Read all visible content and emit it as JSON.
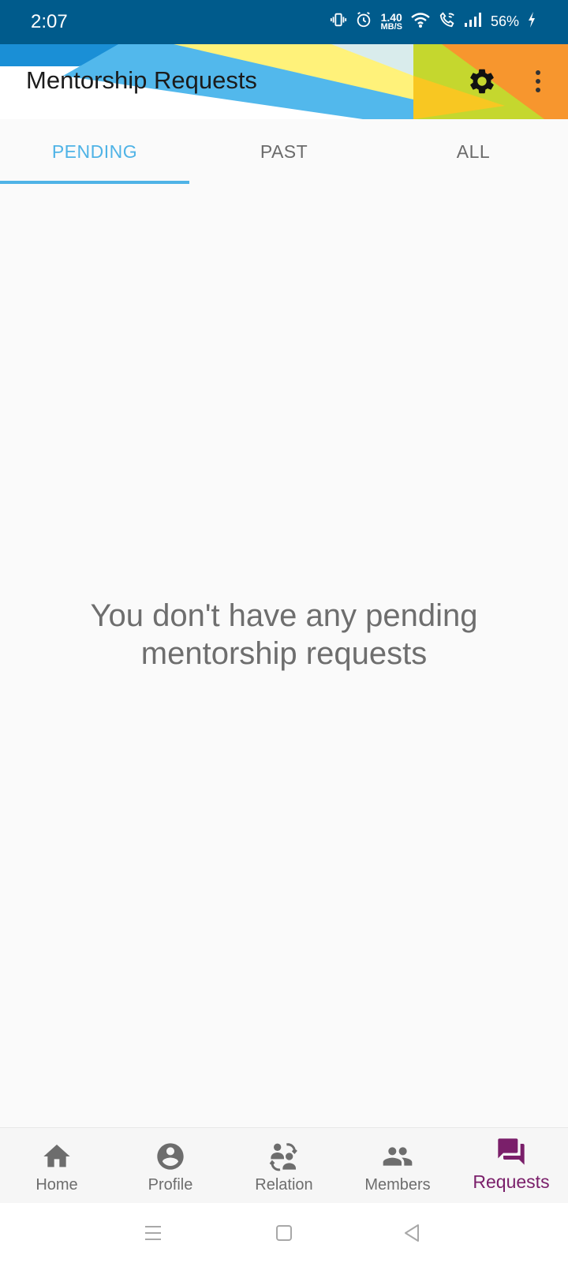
{
  "status_bar": {
    "time": "2:07",
    "net_speed_value": "1.40",
    "net_speed_unit": "MB/S",
    "battery": "56%",
    "icons": [
      "vibrate-icon",
      "alarm-icon",
      "wifi-icon",
      "wifi-calling-icon",
      "signal-icon",
      "battery-charging-icon"
    ]
  },
  "header": {
    "title": "Mentorship Requests",
    "settings_icon": "gear-icon",
    "more_icon": "more-vertical-icon"
  },
  "tabs": [
    {
      "label": "PENDING",
      "active": true
    },
    {
      "label": "PAST",
      "active": false
    },
    {
      "label": "ALL",
      "active": false
    }
  ],
  "main": {
    "empty_message": "You don't have any pending mentorship requests"
  },
  "bottom_nav": {
    "items": [
      {
        "label": "Home",
        "icon": "home-icon",
        "active": false
      },
      {
        "label": "Profile",
        "icon": "account-circle-icon",
        "active": false
      },
      {
        "label": "Relation",
        "icon": "relation-icon",
        "active": false
      },
      {
        "label": "Members",
        "icon": "people-icon",
        "active": false
      },
      {
        "label": "Requests",
        "icon": "forum-icon",
        "active": true
      }
    ]
  },
  "system_nav": {
    "icons": [
      "recents-icon",
      "home-square-icon",
      "back-icon"
    ]
  },
  "colors": {
    "status_bar": "#005b8c",
    "tab_active": "#4fb3e6",
    "nav_active": "#7a1f6a",
    "nav_inactive": "#6d6d6d",
    "banner_blue": "#4fb3e6",
    "banner_yellow": "#fff27a",
    "banner_green": "#c5d72e",
    "banner_orange": "#f7962e"
  }
}
